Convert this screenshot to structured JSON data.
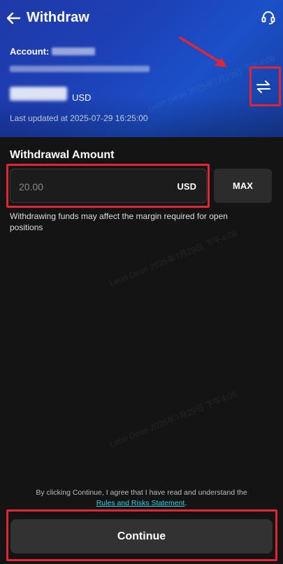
{
  "header": {
    "title": "Withdraw",
    "account_label": "Account:",
    "balance_currency": "USD",
    "last_updated": "Last updated at 2025-07-29 16:25:00",
    "background_color": "#1d3fb5"
  },
  "form": {
    "section_label": "Withdrawal Amount",
    "amount_value": "20.00",
    "amount_currency": "USD",
    "max_label": "MAX",
    "note": "Withdrawing funds may affect the margin required for open positions"
  },
  "footer": {
    "consent_prefix": "By clicking Continue, I agree that I have read and understand the ",
    "consent_link": "Rules and Risks Statement",
    "consent_suffix": ".",
    "continue_label": "Continue",
    "link_color": "#2fd0e5"
  },
  "watermark": {
    "text": "Leon Dean 2025年7月29日 下午4:08"
  },
  "annotations": {
    "highlight_color": "#e32434"
  },
  "icons": [
    "arrow-left-icon",
    "headset-icon",
    "swap-icon"
  ]
}
